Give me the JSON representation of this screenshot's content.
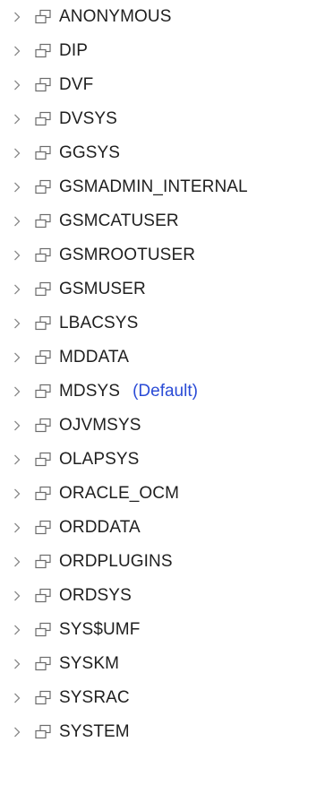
{
  "tree": {
    "items": [
      {
        "label": "ANONYMOUS",
        "badge": ""
      },
      {
        "label": "DIP",
        "badge": ""
      },
      {
        "label": "DVF",
        "badge": ""
      },
      {
        "label": "DVSYS",
        "badge": ""
      },
      {
        "label": "GGSYS",
        "badge": ""
      },
      {
        "label": "GSMADMIN_INTERNAL",
        "badge": ""
      },
      {
        "label": "GSMCATUSER",
        "badge": ""
      },
      {
        "label": "GSMROOTUSER",
        "badge": ""
      },
      {
        "label": "GSMUSER",
        "badge": ""
      },
      {
        "label": "LBACSYS",
        "badge": ""
      },
      {
        "label": "MDDATA",
        "badge": ""
      },
      {
        "label": "MDSYS",
        "badge": "(Default)"
      },
      {
        "label": "OJVMSYS",
        "badge": ""
      },
      {
        "label": "OLAPSYS",
        "badge": ""
      },
      {
        "label": "ORACLE_OCM",
        "badge": ""
      },
      {
        "label": "ORDDATA",
        "badge": ""
      },
      {
        "label": "ORDPLUGINS",
        "badge": ""
      },
      {
        "label": "ORDSYS",
        "badge": ""
      },
      {
        "label": "SYS$UMF",
        "badge": ""
      },
      {
        "label": "SYSKM",
        "badge": ""
      },
      {
        "label": "SYSRAC",
        "badge": ""
      },
      {
        "label": "SYSTEM",
        "badge": ""
      }
    ],
    "item_icon": "schema-icon",
    "expander_icon": "chevron-right-icon",
    "colors": {
      "text": "#1f1f1f",
      "badge": "#2a4bd6",
      "icon": "#6b6b6b"
    }
  }
}
